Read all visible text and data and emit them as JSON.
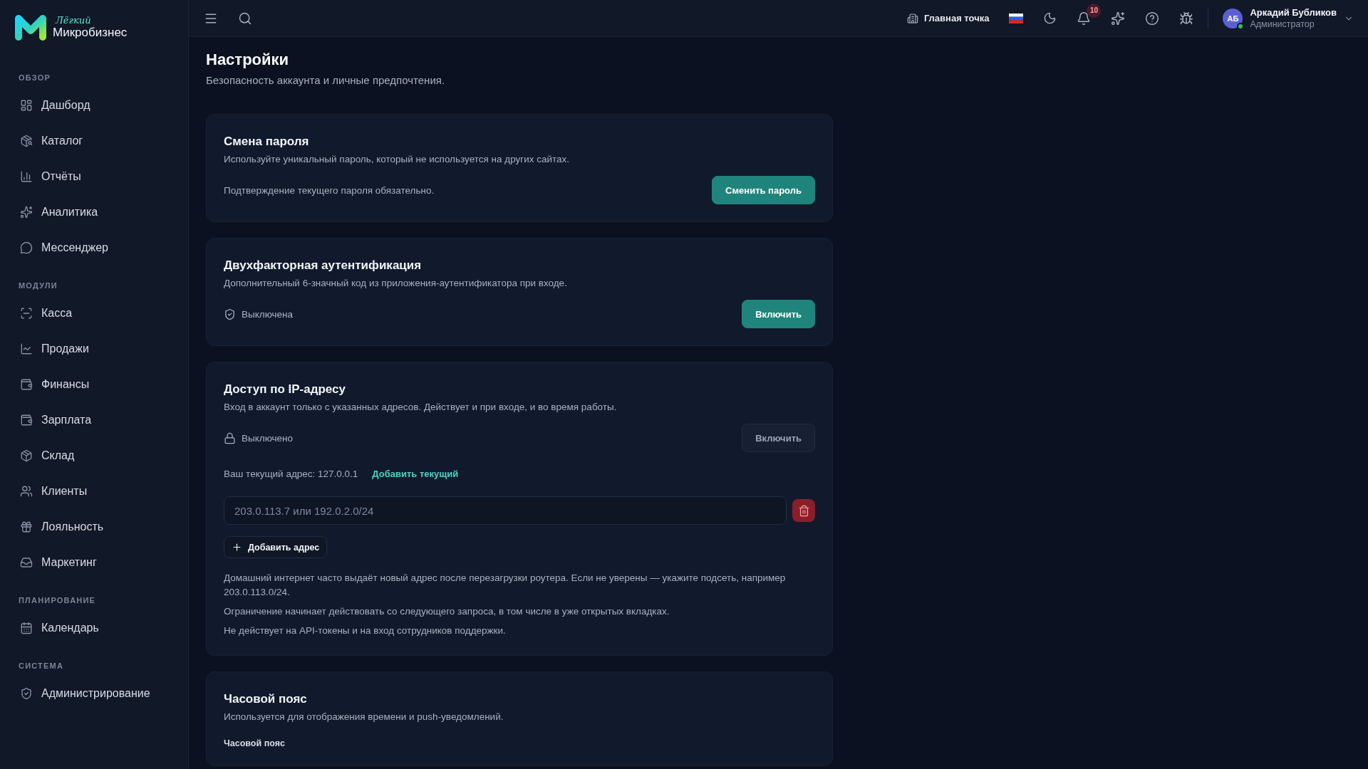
{
  "brand": {
    "tagline": "Лёгкий",
    "name": "Микробизнес"
  },
  "sidebar": {
    "groups": [
      {
        "label": "ОБЗОР",
        "items": [
          {
            "label": "Дашборд",
            "selected": false
          },
          {
            "label": "Каталог",
            "selected": false
          },
          {
            "label": "Отчёты",
            "selected": false
          },
          {
            "label": "Аналитика",
            "selected": false
          },
          {
            "label": "Мессенджер",
            "selected": false
          }
        ]
      },
      {
        "label": "МОДУЛИ",
        "items": [
          {
            "label": "Касса",
            "selected": false
          },
          {
            "label": "Продажи",
            "selected": false
          },
          {
            "label": "Финансы",
            "selected": false
          },
          {
            "label": "Зарплата",
            "selected": false
          },
          {
            "label": "Склад",
            "selected": false
          },
          {
            "label": "Клиенты",
            "selected": false
          },
          {
            "label": "Лояльность",
            "selected": false
          },
          {
            "label": "Маркетинг",
            "selected": false
          }
        ]
      },
      {
        "label": "ПЛАНИРОВАНИЕ",
        "items": [
          {
            "label": "Календарь",
            "selected": false
          }
        ]
      },
      {
        "label": "СИСТЕМА",
        "items": [
          {
            "label": "Администрирование",
            "selected": false
          }
        ]
      }
    ]
  },
  "topbar": {
    "location": "Главная точка",
    "notifications_badge": "10",
    "user": {
      "initials": "АБ",
      "name": "Аркадий Бубликов",
      "role": "Администратор",
      "online": true
    }
  },
  "page": {
    "title": "Настройки",
    "subtitle": "Безопасность аккаунта и личные предпочтения."
  },
  "cards": [
    {
      "kind": "password",
      "title": "Смена пароля",
      "description": "Используйте уникальный пароль, который не используется на других сайтах.",
      "note": "Подтверждение текущего пароля обязательно.",
      "button": {
        "label": "Сменить пароль",
        "disabled": false
      }
    },
    {
      "kind": "two_factor",
      "title": "Двухфакторная аутентификация",
      "description": "Дополнительный 6-значный код из приложения-аутентификатора при входе.",
      "status": "Выключена",
      "button": {
        "label": "Включить",
        "disabled": false
      }
    },
    {
      "kind": "ip_access",
      "title": "Доступ по IP-адресу",
      "description": "Вход в аккаунт только с указанных адресов. Действует и при входе, и во время работы.",
      "status": "Выключено",
      "button": {
        "label": "Включить",
        "disabled": true
      },
      "current_address": "Ваш текущий адрес: 127.0.0.1",
      "add_current": "Добавить текущий",
      "addresses": [
        {
          "placeholder": "203.0.113.7 или 192.0.2.0/24"
        }
      ],
      "add_address": "Добавить адрес",
      "notes": [
        "Домашний интернет часто выдаёт новый адрес после перезагрузки роутера. Если не уверены — укажите подсеть, например 203.0.113.0/24.",
        "Ограничение начинает действовать со следующего запроса, в том числе в уже открытых вкладках.",
        "Не действует на API-токены и на вход сотрудников поддержки."
      ]
    },
    {
      "kind": "timezone",
      "title": "Часовой пояс",
      "description": "Используется для отображения времени и push-уведомлений.",
      "field_label": "Часовой пояс"
    }
  ]
}
